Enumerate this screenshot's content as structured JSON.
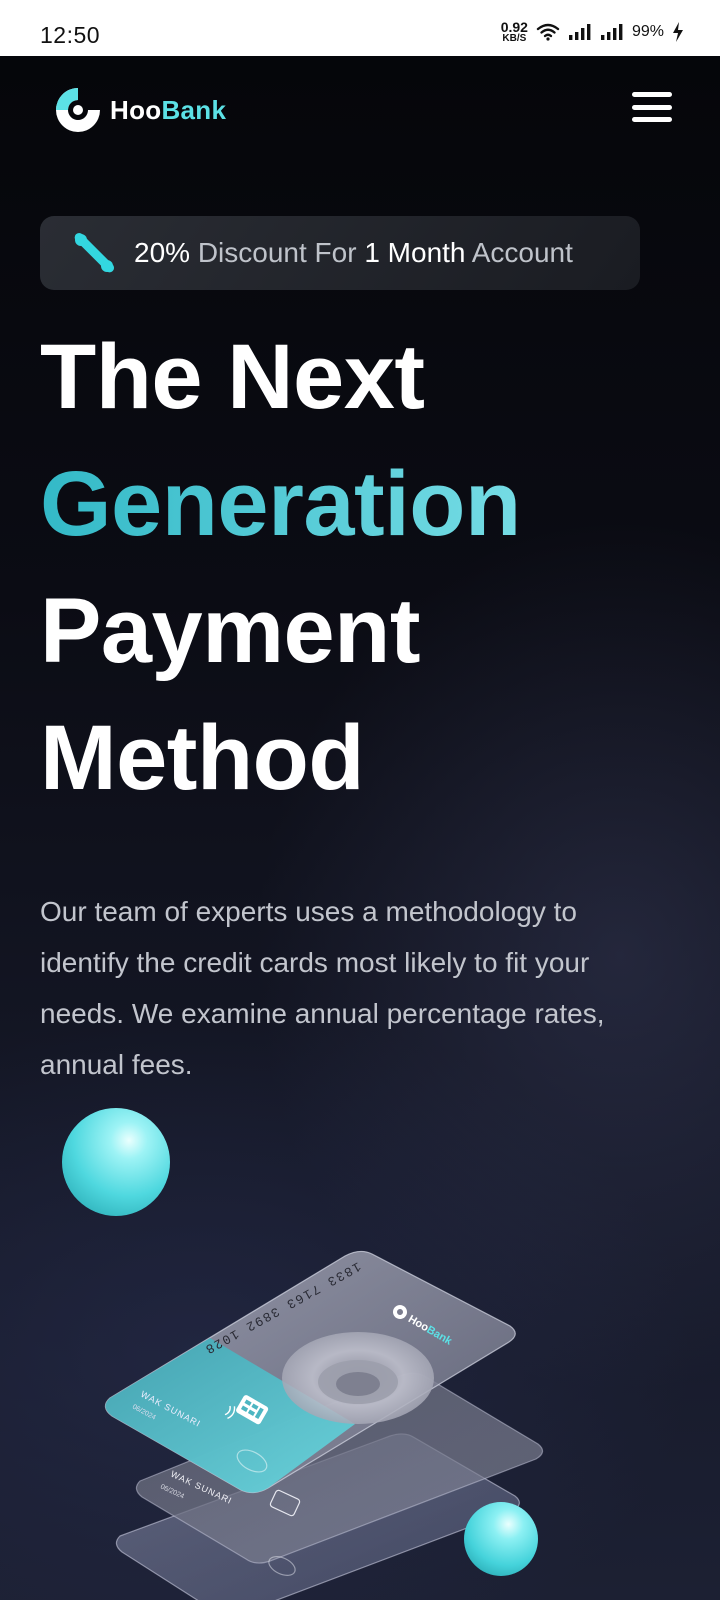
{
  "status_bar": {
    "time": "12:50",
    "net_speed_value": "0.92",
    "net_speed_unit": "KB/S",
    "battery": "99%"
  },
  "navbar": {
    "logo_text_a": "Hoo",
    "logo_text_b": "Bank",
    "menu_icon": "hamburger-menu-icon"
  },
  "promo": {
    "icon": "percent-icon",
    "highlight_1": "20%",
    "text_1": " Discount For ",
    "highlight_2": "1 Month",
    "text_2": " Account"
  },
  "hero": {
    "title_line_1": "The Next",
    "title_line_2": "Generation",
    "title_line_3": "Payment",
    "title_line_4": "Method",
    "description": "Our team of experts uses a methodology to identify the credit cards most likely to fit your needs. We examine annual percentage rates, annual fees."
  },
  "cards": {
    "card_number": "1833 7163 3892 1028",
    "card_brand_a": "Hoo",
    "card_brand_b": "Bank",
    "holder_name": "WAK SUNARI",
    "expiry": "06/2024"
  },
  "colors": {
    "accent": "#5ce1e6",
    "gradient_start": "#33b9c7",
    "gradient_end": "#8ee9f0",
    "background": "#0b0c14"
  }
}
